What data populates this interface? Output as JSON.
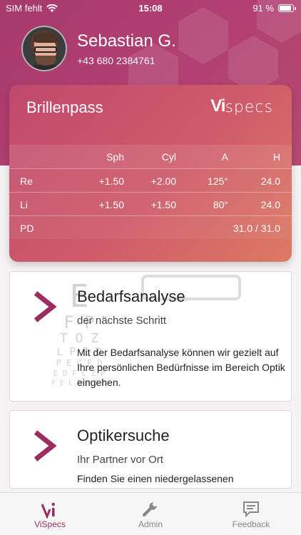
{
  "status_bar": {
    "carrier": "SIM fehlt",
    "time": "15:08",
    "battery": "91 %"
  },
  "profile": {
    "name": "Sebastian G.",
    "phone": "+43 680 2384761"
  },
  "pass": {
    "title": "Brillenpass",
    "logo_vi": "Vi",
    "logo_specs": "specs",
    "headers": [
      "",
      "Sph",
      "Cyl",
      "A",
      "H"
    ],
    "rows": [
      {
        "label": "Re",
        "sph": "+1.50",
        "cyl": "+2.00",
        "a": "125°",
        "h": "24.0"
      },
      {
        "label": "Li",
        "sph": "+1.50",
        "cyl": "+1.50",
        "a": "80°",
        "h": "24.0"
      }
    ],
    "pd_label": "PD",
    "pd_value": "31.0 / 31.0"
  },
  "cards": [
    {
      "title": "Bedarfsanalyse",
      "subtitle": "der nächste Schritt",
      "body": "Mit der Bedarfsanalyse können wir gezielt auf Ihre persönlichen Bedürfnisse im Bereich Optik eingehen."
    },
    {
      "title": "Optikersuche",
      "subtitle": "Ihr Partner vor Ort",
      "body": "Finden Sie einen niedergelassenen"
    }
  ],
  "tabs": [
    {
      "label": "ViSpecs",
      "icon": "vispecs-logo-icon",
      "active": true
    },
    {
      "label": "Admin",
      "icon": "wrench-icon",
      "active": false
    },
    {
      "label": "Feedback",
      "icon": "feedback-icon",
      "active": false
    }
  ],
  "colors": {
    "brand": "#a73a6b",
    "card_gradient_start": "#c0496c",
    "card_gradient_end": "#dc7a62",
    "chevron": "#9b2d61"
  },
  "eyechart": {
    "lines": [
      "E",
      "F P",
      "T O Z",
      "L P E D",
      "P E C F D",
      "E D F C Z P",
      "F E L O P Z D"
    ]
  }
}
